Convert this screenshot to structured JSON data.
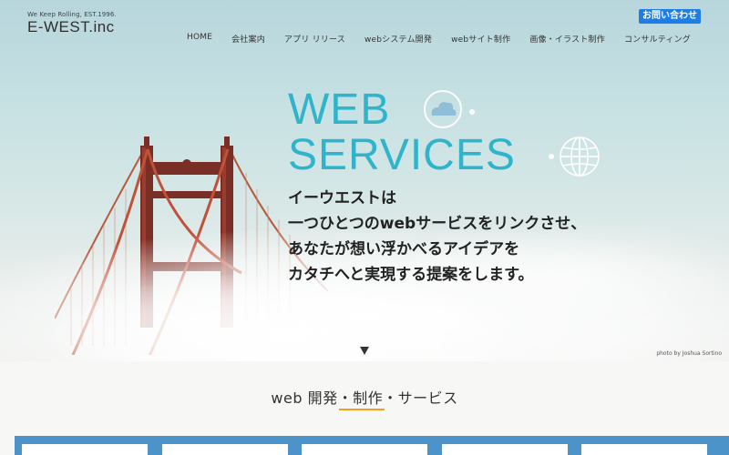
{
  "header": {
    "logo_tagline": "We Keep Rolling, EST.1996.",
    "logo_name": "E-WEST.inc",
    "contact_label": "お問い合わせ"
  },
  "nav": {
    "items": [
      {
        "label": "HOME"
      },
      {
        "label": "会社案内"
      },
      {
        "label": "アプリ リリース"
      },
      {
        "label": "webシステム開発"
      },
      {
        "label": "webサイト制作"
      },
      {
        "label": "画像・イラスト制作"
      },
      {
        "label": "コンサルティング"
      }
    ]
  },
  "hero": {
    "headline_line1": "WEB",
    "headline_line2": "SERVICES",
    "tagline_lines": [
      "イーウエストは",
      "一つひとつのwebサービスをリンクさせ、",
      "あなたが想い浮かべるアイデアを",
      "カタチへと実現する提案をします。"
    ],
    "photo_credit": "photo by Joshua Sortino",
    "accent_color": "#2fb4cc"
  },
  "services": {
    "title": "web 開発・制作・サービス",
    "underline_color": "#f4a11f",
    "band_color": "#4c93c9"
  }
}
